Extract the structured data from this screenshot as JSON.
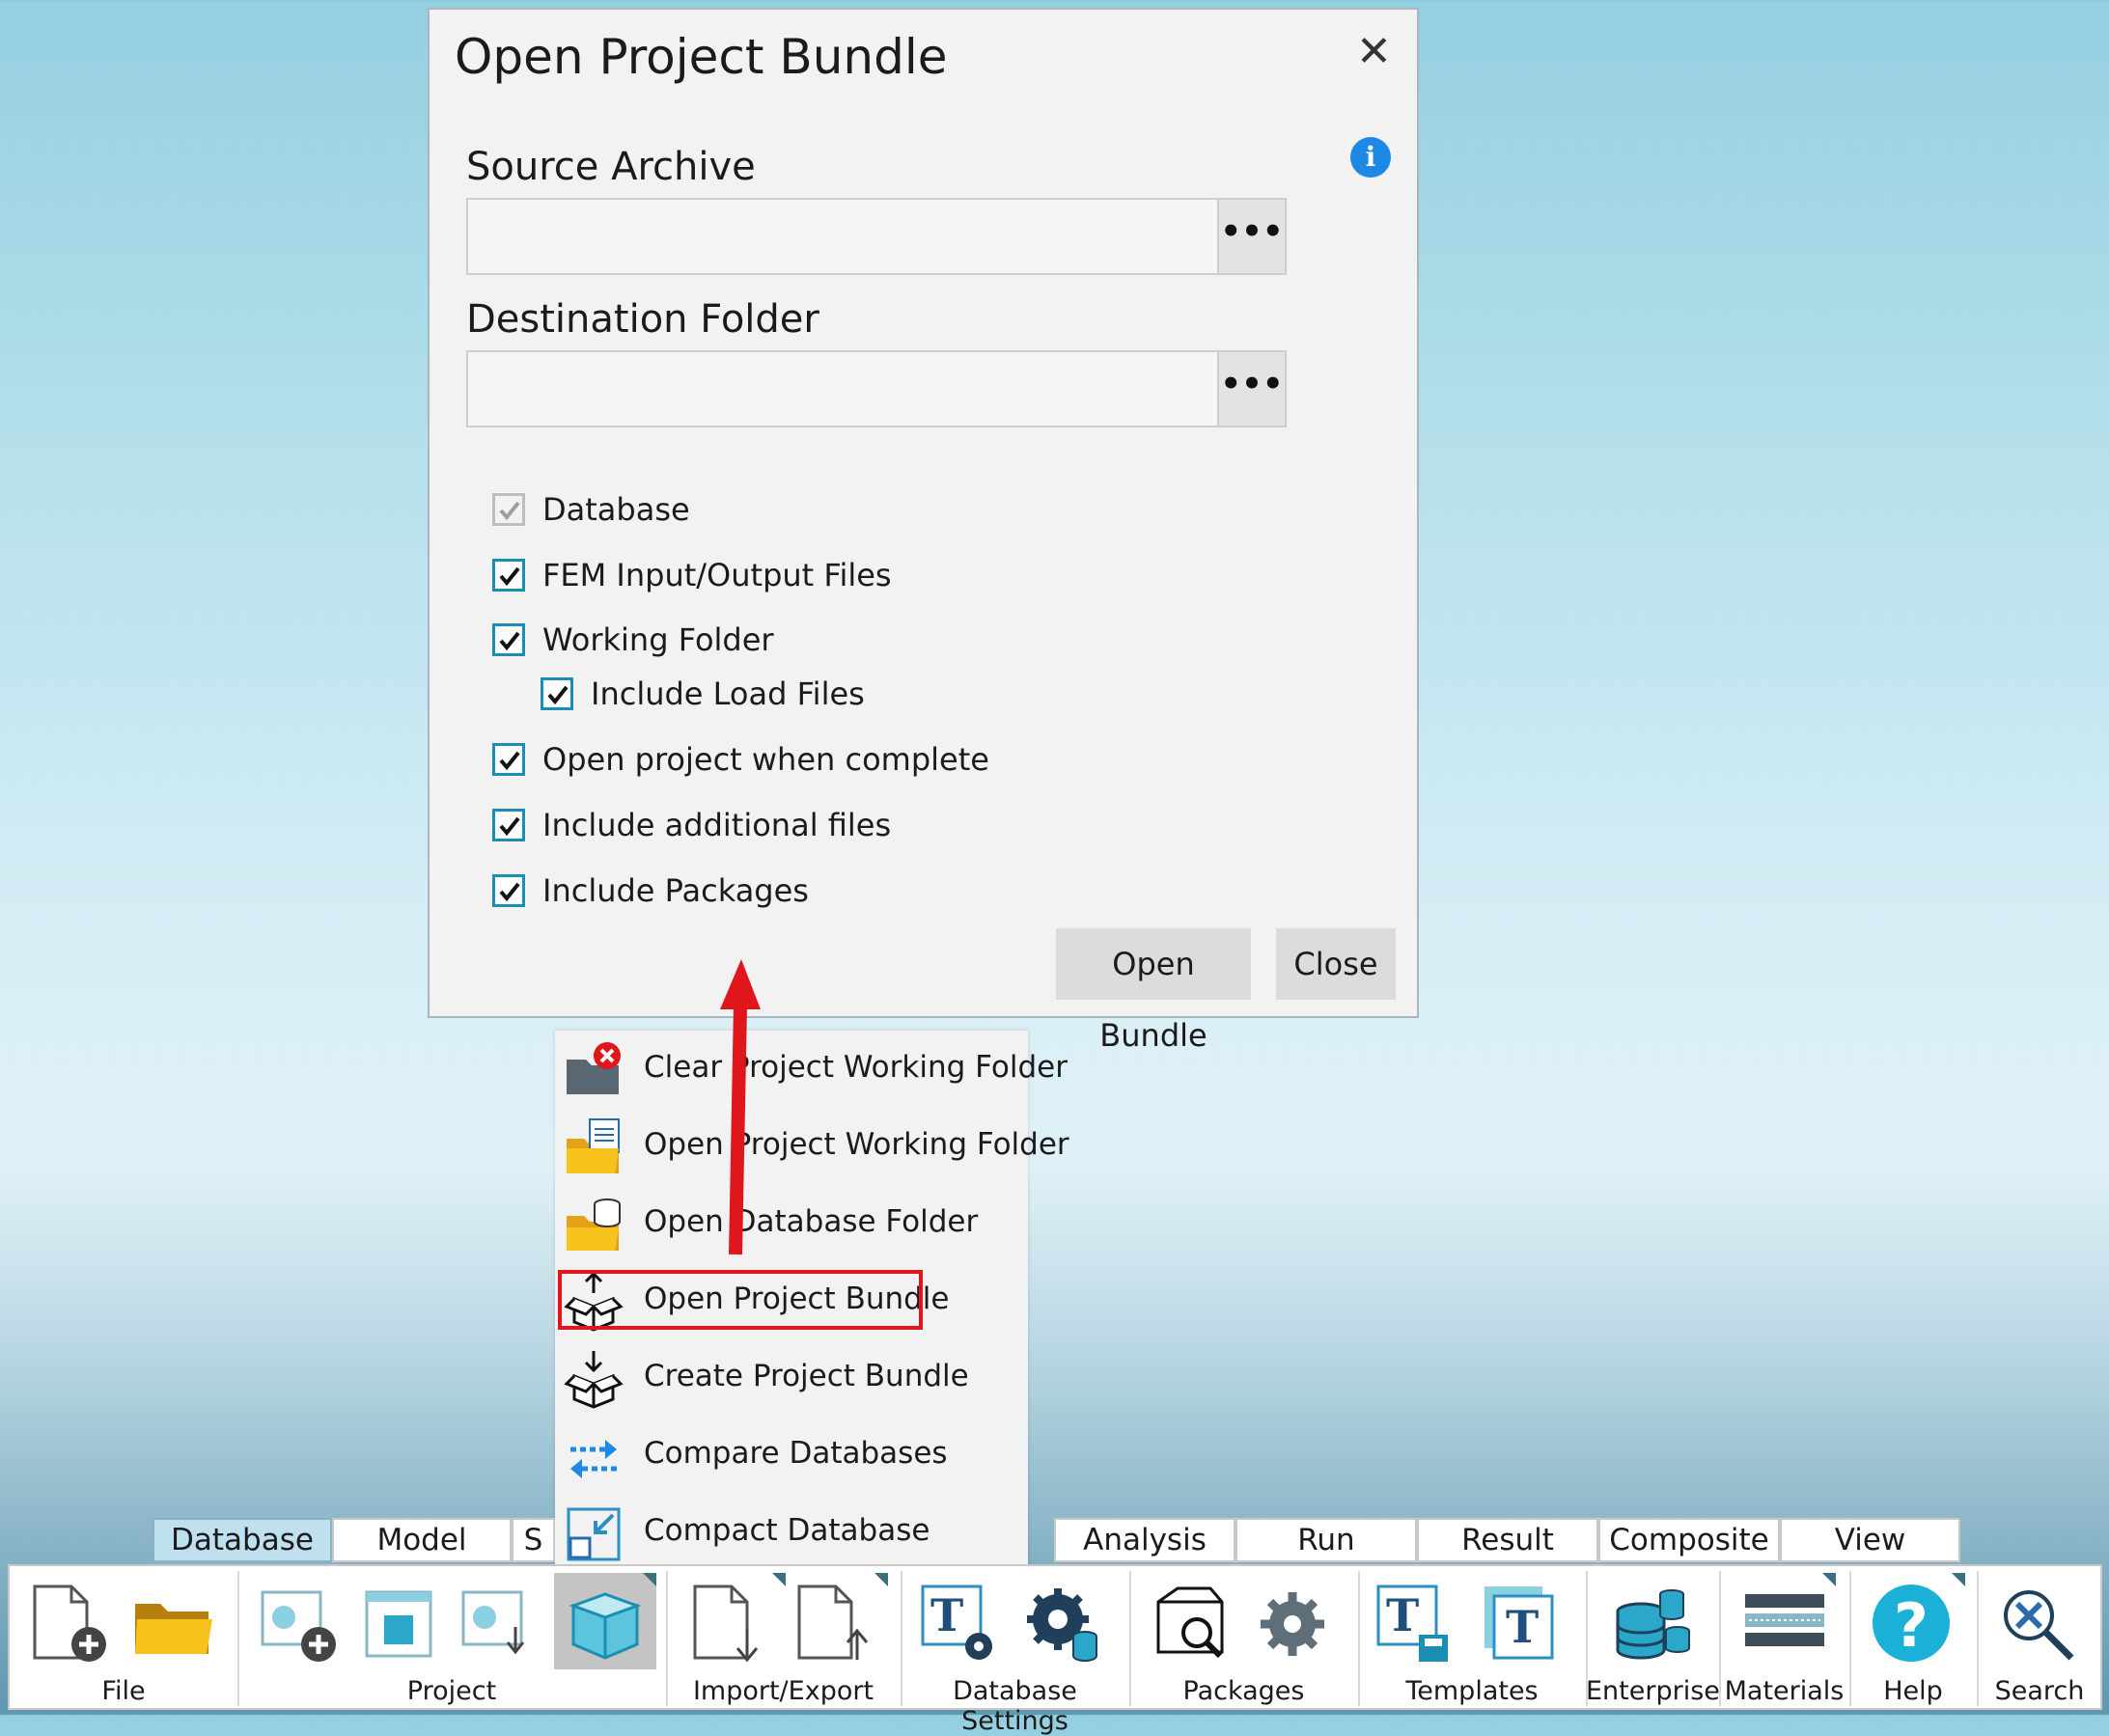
{
  "dialog": {
    "title": "Open Project Bundle",
    "close_glyph": "✕",
    "info_glyph": "i",
    "source_label": "Source Archive",
    "source_value": "",
    "destination_label": "Destination Folder",
    "destination_value": "",
    "browse_label": "•••",
    "checkboxes": [
      {
        "label": "Database",
        "checked": true,
        "disabled": true
      },
      {
        "label": "FEM Input/Output Files",
        "checked": true
      },
      {
        "label": "Working Folder",
        "checked": true
      },
      {
        "label": "Include Load Files",
        "checked": true
      },
      {
        "label": "Open project when complete",
        "checked": true
      },
      {
        "label": "Include additional files",
        "checked": true
      },
      {
        "label": "Include Packages",
        "checked": true
      }
    ],
    "open_bundle_label": "Open Bundle",
    "close_label": "Close"
  },
  "menu": {
    "items": [
      {
        "label": "Clear Project Working Folder",
        "icon": "folder-clear-icon"
      },
      {
        "label": "Open Project Working Folder",
        "icon": "folder-open-icon"
      },
      {
        "label": "Open Database Folder",
        "icon": "database-folder-icon"
      },
      {
        "label": "Open Project Bundle",
        "icon": "open-bundle-icon",
        "highlighted": true
      },
      {
        "label": "Create Project Bundle",
        "icon": "create-bundle-icon"
      },
      {
        "label": "Compare Databases",
        "icon": "compare-icon"
      },
      {
        "label": "Compact Database",
        "icon": "compact-icon"
      }
    ]
  },
  "tabs": [
    "Database",
    "Model",
    "S",
    "Analysis",
    "Run",
    "Result",
    "Composite",
    "View"
  ],
  "active_tab": "Database",
  "ribbon": {
    "groups": [
      "File",
      "Project",
      "Import/Export",
      "Database Settings",
      "Packages",
      "Templates",
      "Enterprise",
      "Materials",
      "Help",
      "Search"
    ]
  },
  "colors": {
    "accent": "#1a8fb4",
    "highlight_border": "#e0161d",
    "arrow": "#e0161d",
    "active_tab": "#bfe0ef"
  }
}
